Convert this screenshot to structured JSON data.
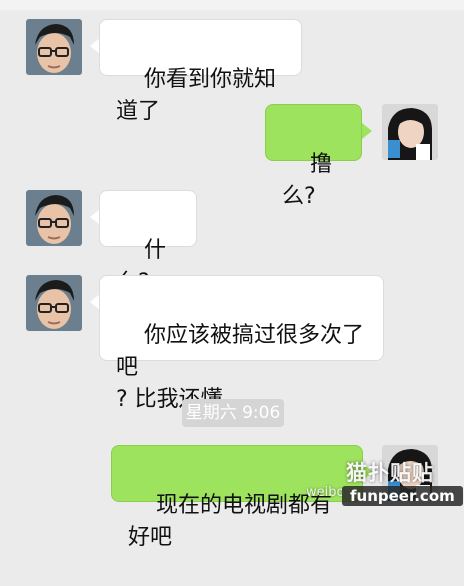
{
  "messages": [
    {
      "side": "left",
      "text": "你看到你就知道了",
      "avatar": "boy-glasses-avatar"
    },
    {
      "side": "right",
      "text": "撸么?",
      "avatar": "girl-avatar"
    },
    {
      "side": "left",
      "text": "什么?",
      "avatar": "boy-glasses-avatar"
    },
    {
      "side": "left",
      "text": "你应该被搞过很多次了吧\n? 比我还懂",
      "avatar": "boy-glasses-avatar"
    },
    {
      "side": "right",
      "text": "现在的电视剧都有好吧",
      "avatar": "girl-avatar"
    }
  ],
  "timestamp": "星期六 9:06",
  "watermark": {
    "logo_text": "猫扑贴贴",
    "site": "funpeer.com",
    "weibo": "weibo"
  },
  "colors": {
    "background": "#ebebeb",
    "left_bubble": "#ffffff",
    "right_bubble": "#9ee35e"
  }
}
